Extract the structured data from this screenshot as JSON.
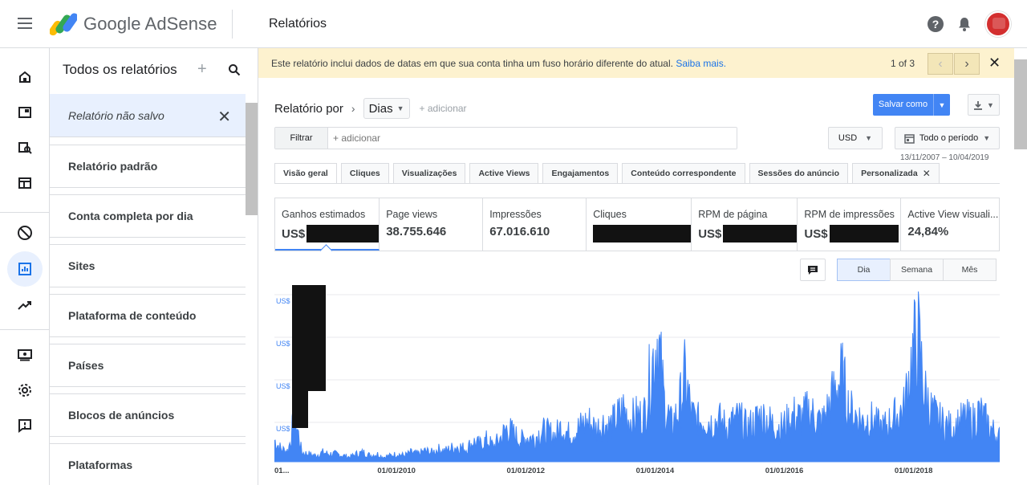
{
  "app": {
    "brand": "Google AdSense",
    "page_title": "Relatórios"
  },
  "sidebar": {
    "title": "Todos os relatórios",
    "plus": "+",
    "items": [
      {
        "label": "Relatório não salvo"
      },
      {
        "label": "Relatório padrão"
      },
      {
        "label": "Conta completa por dia"
      },
      {
        "label": "Sites"
      },
      {
        "label": "Plataforma de conteúdo"
      },
      {
        "label": "Países"
      },
      {
        "label": "Blocos de anúncios"
      },
      {
        "label": "Plataformas"
      }
    ],
    "close": "✕"
  },
  "banner": {
    "text": "Este relatório inclui dados de datas em que sua conta tinha um fuso horário diferente do atual.",
    "link": "Saiba mais.",
    "count": "1 of 3",
    "prev": "‹",
    "next": "›",
    "close": "✕"
  },
  "toolbar": {
    "report_by": "Relatório por",
    "chevron": "›",
    "dimension": "Dias",
    "add_dimension": "+ adicionar",
    "save": "Salvar como",
    "filter": "Filtrar",
    "filter_placeholder": "+ adicionar",
    "currency": "USD",
    "period": "Todo o período",
    "date_range": "13/11/2007 – 10/04/2019"
  },
  "tabs": [
    {
      "label": "Visão geral",
      "active": true
    },
    {
      "label": "Cliques"
    },
    {
      "label": "Visualizações"
    },
    {
      "label": "Active Views"
    },
    {
      "label": "Engajamentos"
    },
    {
      "label": "Conteúdo correspondente"
    },
    {
      "label": "Sessões do anúncio"
    },
    {
      "label": "Personalizada",
      "closable": true
    }
  ],
  "tab_close": "✕",
  "metrics": [
    {
      "label": "Ganhos estimados",
      "prefix": "US$",
      "value": "",
      "redacted": true,
      "active": true
    },
    {
      "label": "Page views",
      "prefix": "",
      "value": "38.755.646"
    },
    {
      "label": "Impressões",
      "prefix": "",
      "value": "67.016.610"
    },
    {
      "label": "Cliques",
      "prefix": "",
      "value": "",
      "redacted": true
    },
    {
      "label": "RPM de página",
      "prefix": "US$",
      "value": "",
      "redacted": true
    },
    {
      "label": "RPM de impressões",
      "prefix": "US$",
      "value": "",
      "redacted": true
    },
    {
      "label": "Active View visuali...",
      "prefix": "",
      "value": "24,84%"
    }
  ],
  "granularity": [
    {
      "label": "Dia",
      "active": true
    },
    {
      "label": "Semana"
    },
    {
      "label": "Mês"
    }
  ],
  "colors": {
    "accent": "#4285f4",
    "banner_bg": "#fdf2cf"
  },
  "chart_data": {
    "type": "area",
    "series": [
      {
        "values": [
          0.14,
          0.08,
          0.07,
          0.3,
          0.06,
          0.05,
          0.04,
          0.06,
          0.05,
          0.05,
          0.04,
          0.03,
          0.05,
          0.06,
          0.04,
          0.05,
          0.03,
          0.04,
          0.05,
          0.04,
          0.06,
          0.05,
          0.07,
          0.06,
          0.08,
          0.07,
          0.09,
          0.1,
          0.08,
          0.13,
          0.11,
          0.14,
          0.1,
          0.15,
          0.22,
          0.18,
          0.14,
          0.16,
          0.15,
          0.2,
          0.19,
          0.17,
          0.23,
          0.18,
          0.2,
          0.24,
          0.26,
          0.21,
          0.25,
          0.23,
          0.28,
          0.34,
          0.27,
          0.3,
          0.29,
          0.58,
          0.82,
          0.38,
          0.24,
          0.32,
          0.55,
          0.3,
          0.26,
          0.28,
          0.25,
          0.27,
          0.23,
          0.26,
          0.28,
          0.22,
          0.25,
          0.3,
          0.27,
          0.24,
          0.22,
          0.26,
          0.3,
          0.28,
          0.33,
          0.29,
          0.25,
          0.35,
          0.48,
          0.55,
          0.33,
          0.3,
          0.26,
          0.28,
          0.24,
          0.22,
          0.26,
          0.3,
          0.34,
          0.62,
          0.83,
          0.45,
          0.33,
          0.27,
          0.24,
          0.22,
          0.25,
          0.28,
          0.26,
          0.32,
          0.26,
          0.2,
          0.16
        ]
      }
    ],
    "x": [
      "01...",
      "",
      "",
      "",
      "",
      "",
      "",
      "",
      "",
      "",
      "",
      "",
      "",
      "",
      "",
      "",
      "",
      "01/01/2010",
      "",
      "",
      "",
      "",
      "",
      "",
      "",
      "",
      "",
      "",
      "",
      "",
      "",
      "",
      "",
      "",
      "",
      "01/01/2012",
      "",
      "",
      "",
      "",
      "",
      "",
      "",
      "",
      "",
      "",
      "",
      "",
      "",
      "",
      "",
      "",
      "",
      "01/01/2014",
      "",
      "",
      "",
      "",
      "",
      "",
      "",
      "",
      "",
      "",
      "",
      "",
      "",
      "",
      "",
      "",
      "",
      "01/01/2016",
      "",
      "",
      "",
      "",
      "",
      "",
      "",
      "",
      "",
      "",
      "",
      "",
      "",
      "",
      "",
      "",
      "",
      "01/01/2018",
      "",
      "",
      "",
      "",
      "",
      "",
      "",
      "",
      "",
      "",
      "",
      ""
    ],
    "ylabel_prefix": "US$",
    "xlabel": "",
    "ylim": [
      0,
      1
    ],
    "grid": true,
    "x_ticks": [
      "01...",
      "01/01/2010",
      "01/01/2012",
      "01/01/2014",
      "01/01/2016",
      "01/01/2018"
    ],
    "y_ticks": [
      "US$",
      "US$",
      "US$",
      "US$"
    ]
  }
}
